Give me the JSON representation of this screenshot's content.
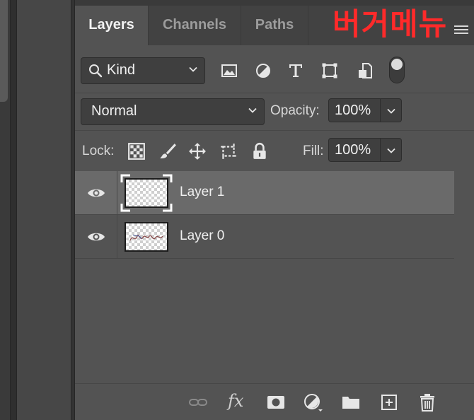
{
  "tabs": [
    {
      "label": "Layers",
      "active": true
    },
    {
      "label": "Channels",
      "active": false
    },
    {
      "label": "Paths",
      "active": false
    }
  ],
  "annotation": {
    "text": "버거메뉴",
    "color": "#ff2a2a"
  },
  "filter": {
    "kind_label": "Kind",
    "icons": [
      "image-filter-icon",
      "adjustment-filter-icon",
      "type-filter-icon",
      "shape-filter-icon",
      "smart-object-filter-icon"
    ]
  },
  "blend": {
    "mode": "Normal",
    "opacity_label": "Opacity:",
    "opacity_value": "100%"
  },
  "lock": {
    "label": "Lock:",
    "fill_label": "Fill:",
    "fill_value": "100%"
  },
  "layers": [
    {
      "name": "Layer 1",
      "visible": true,
      "selected": true
    },
    {
      "name": "Layer 0",
      "visible": true,
      "selected": false
    }
  ],
  "bottom_icons": [
    "link-icon",
    "fx-icon",
    "mask-icon",
    "adjustment-icon",
    "folder-icon",
    "new-layer-icon",
    "trash-icon"
  ],
  "fx_label": "fx",
  "colors": {
    "panel": "#535353",
    "tabbar": "#424242",
    "selected_row": "#6a6a6a"
  }
}
